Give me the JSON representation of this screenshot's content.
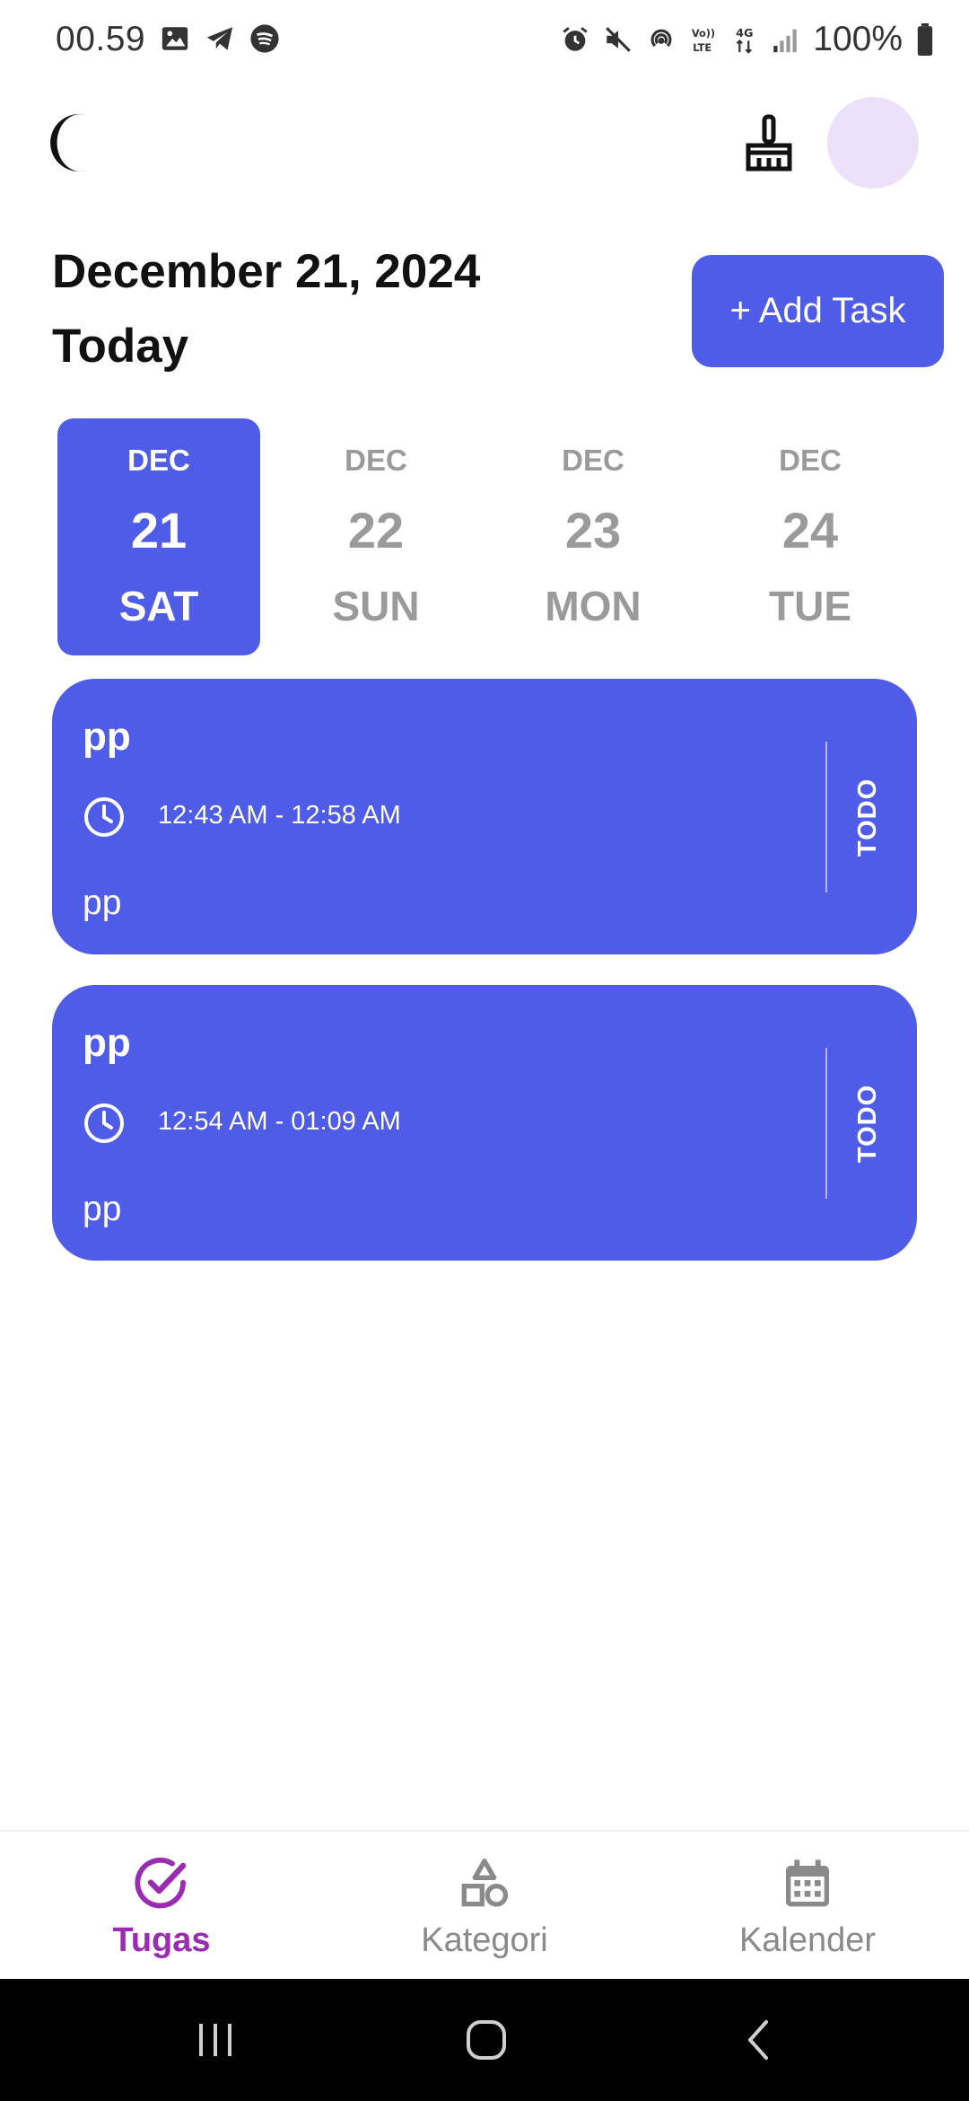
{
  "status_bar": {
    "time": "00.59",
    "battery": "100%",
    "left_icons": [
      "image-icon",
      "telegram-icon",
      "spotify-icon"
    ],
    "right_icons": [
      "alarm-icon",
      "mute-icon",
      "hotspot-icon",
      "volte-icon",
      "4g-icon",
      "signal-icon",
      "battery-icon"
    ]
  },
  "header": {
    "date": "December 21, 2024",
    "subtitle": "Today",
    "add_task_label": "+ Add Task"
  },
  "date_strip": [
    {
      "month": "DEC",
      "day": "21",
      "weekday": "SAT",
      "selected": true
    },
    {
      "month": "DEC",
      "day": "22",
      "weekday": "SUN",
      "selected": false
    },
    {
      "month": "DEC",
      "day": "23",
      "weekday": "MON",
      "selected": false
    },
    {
      "month": "DEC",
      "day": "24",
      "weekday": "TUE",
      "selected": false
    }
  ],
  "tasks": [
    {
      "title": "pp",
      "time": "12:43 AM - 12:58 AM",
      "description": "pp",
      "status": "TODO"
    },
    {
      "title": "pp",
      "time": "12:54 AM - 01:09 AM",
      "description": "pp",
      "status": "TODO"
    }
  ],
  "bottom_nav": [
    {
      "label": "Tugas",
      "icon": "check-circle-icon",
      "active": true
    },
    {
      "label": "Kategori",
      "icon": "shapes-icon",
      "active": false
    },
    {
      "label": "Kalender",
      "icon": "calendar-icon",
      "active": false
    }
  ],
  "colors": {
    "accent": "#4f5ce8",
    "nav_active": "#9b2bb2",
    "avatar_bg": "#ece0fb"
  }
}
